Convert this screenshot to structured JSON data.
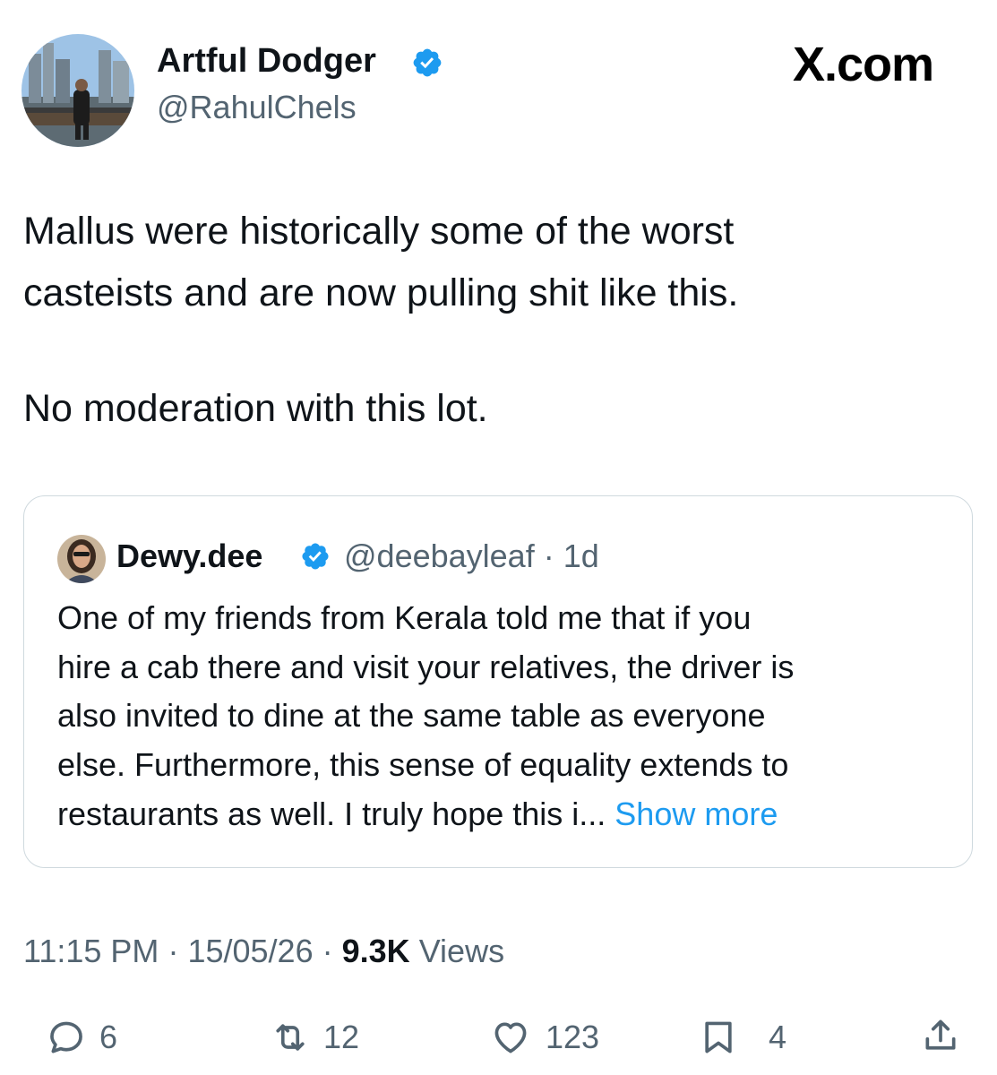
{
  "brand": "X.com",
  "author": {
    "name": "Artful Dodger",
    "handle": "@RahulChels"
  },
  "tweet": {
    "lines": [
      "Mallus were historically some of the worst",
      "casteists and are now pulling shit like this."
    ],
    "line2": "No moderation with this lot."
  },
  "quote": {
    "name": "Dewy.dee",
    "meta": "@deebayleaf · 1d",
    "lines": [
      "One of my friends from Kerala told me that if you",
      "hire a cab there and visit your relatives, the driver is",
      "also invited to dine at the same table as everyone",
      "else. Furthermore, this sense of equality extends to"
    ],
    "last_line": "restaurants as well. I truly hope this i...",
    "show_more": "Show more"
  },
  "meta": {
    "time": "11:15 PM",
    "date": "15/05/26",
    "views_count": "9.3K",
    "views_label": "Views",
    "sep": "·"
  },
  "actions": {
    "replies": "6",
    "reposts": "12",
    "likes": "123",
    "bookmarks": "4"
  },
  "colors": {
    "verified": "#1d9bf0",
    "link": "#1d9bf0",
    "secondary_text": "#536471"
  },
  "icons": [
    "verified-badge-icon",
    "reply-icon",
    "repost-icon",
    "like-icon",
    "bookmark-icon",
    "share-icon"
  ]
}
